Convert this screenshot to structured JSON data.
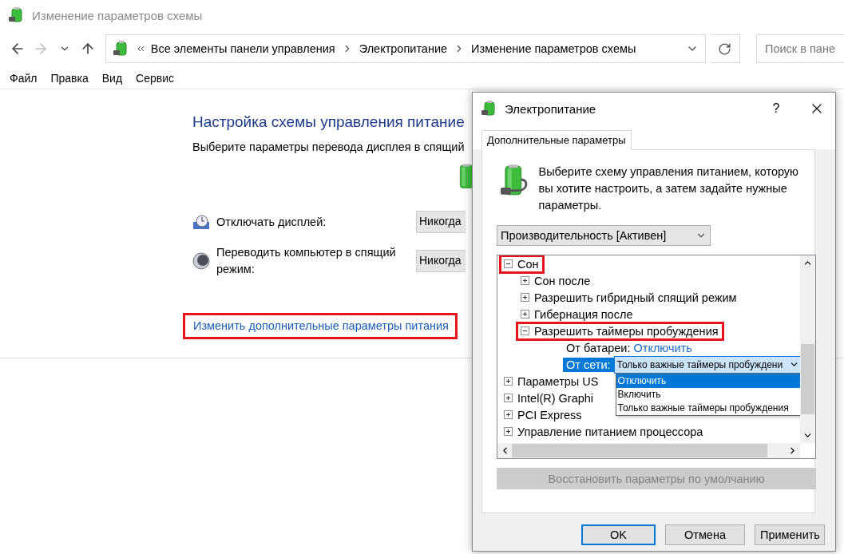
{
  "window": {
    "title": "Изменение параметров схемы"
  },
  "address_bar": {
    "crumbs": [
      "Все элементы панели управления",
      "Электропитание",
      "Изменение параметров схемы"
    ]
  },
  "search": {
    "placeholder": "Поиск в пане"
  },
  "menu": [
    "Файл",
    "Правка",
    "Вид",
    "Сервис"
  ],
  "plan": {
    "heading": "Настройка схемы управления питание",
    "description": "Выберите параметры перевода дисплея в спящий",
    "settings": [
      {
        "kind": "display",
        "label": "Отключать дисплей:",
        "value": "Никогда"
      },
      {
        "kind": "sleep",
        "label": "Переводить компьютер в спящий режим:",
        "value": "Никогда"
      }
    ],
    "link": {
      "text": "Изменить дополнительные параметры питания",
      "highlighted": true
    }
  },
  "dialog": {
    "title": "Электропитание",
    "help": "?",
    "tabs": [
      {
        "label": "Дополнительные параметры",
        "selected": true
      }
    ],
    "intro": "Выберите схему управления питанием, которую вы хотите настроить, а затем задайте нужные параметры.",
    "plan_select": "Производительность [Активен]",
    "tree": [
      {
        "kind": "group",
        "label": "Сон",
        "expanded": true,
        "highlighted": true,
        "children": [
          {
            "kind": "group",
            "label": "Сон после",
            "expanded": false,
            "highlighted": false
          },
          {
            "kind": "group",
            "label": "Разрешить гибридный спящий режим",
            "expanded": false,
            "highlighted": false
          },
          {
            "kind": "group",
            "label": "Гибернация после",
            "expanded": false,
            "highlighted": false
          },
          {
            "kind": "group",
            "label": "Разрешить таймеры пробуждения",
            "expanded": true,
            "highlighted": true,
            "children": [
              {
                "kind": "setting",
                "label": "От батареи:",
                "value": "Отключить",
                "selected": false
              },
              {
                "kind": "setting",
                "label": "От сети:",
                "value": "Только важные таймеры пробуждени",
                "selected": true,
                "options": [
                  {
                    "label": "Отключить",
                    "selected": true
                  },
                  {
                    "label": "Включить",
                    "selected": false
                  },
                  {
                    "label": "Только важные таймеры пробуждения",
                    "selected": false
                  }
                ]
              }
            ]
          }
        ]
      },
      {
        "kind": "group",
        "label": "Параметры US",
        "expanded": false,
        "highlighted": false
      },
      {
        "kind": "group",
        "label": "Intel(R) Graphi",
        "expanded": false,
        "highlighted": false
      },
      {
        "kind": "group",
        "label": "PCI Express",
        "expanded": false,
        "highlighted": false
      },
      {
        "kind": "group",
        "label": "Управление питанием процессора",
        "expanded": false,
        "highlighted": false
      }
    ],
    "restore_button": {
      "label": "Восстановить параметры по умолчанию",
      "disabled": true
    },
    "buttons": [
      {
        "label": "OK",
        "default": true
      },
      {
        "label": "Отмена",
        "default": false
      },
      {
        "label": "Применить",
        "default": false
      }
    ]
  }
}
